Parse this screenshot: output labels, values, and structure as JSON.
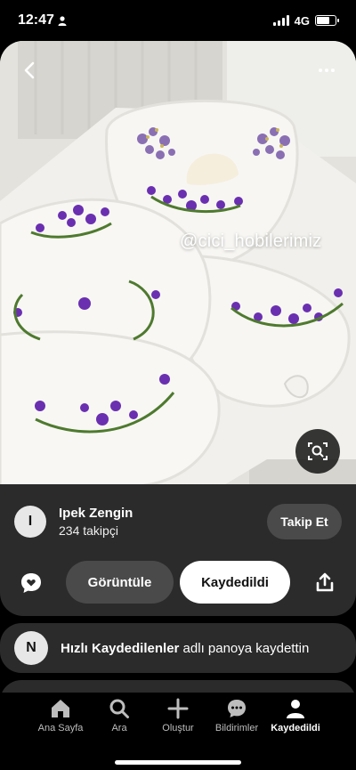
{
  "status_bar": {
    "time": "12:47",
    "network": "4G",
    "battery_level": 0.7
  },
  "pin": {
    "watermark": "@cici_hobilerimiz",
    "icons": {
      "back": "chevron-left-icon",
      "more": "more-horizontal-icon",
      "lens": "visual-search-icon"
    }
  },
  "creator": {
    "initial": "I",
    "name": "Ipek Zengin",
    "followers": "234 takipçi",
    "follow_label": "Takip Et"
  },
  "actions": {
    "view_label": "Görüntüle",
    "saved_label": "Kaydedildi",
    "icons": {
      "comment": "comment-heart-icon",
      "share": "share-icon"
    }
  },
  "board_notice": {
    "initial": "N",
    "board_name": "Hızlı Kaydedilenler",
    "suffix": "adlı panoya kaydettin"
  },
  "tab_bar": {
    "items": [
      {
        "label": "Ana Sayfa",
        "icon": "home-icon",
        "active": false
      },
      {
        "label": "Ara",
        "icon": "search-icon",
        "active": false
      },
      {
        "label": "Oluştur",
        "icon": "plus-icon",
        "active": false
      },
      {
        "label": "Bildirimler",
        "icon": "chat-bubble-icon",
        "active": false
      },
      {
        "label": "Kaydedildi",
        "icon": "profile-icon",
        "active": true
      }
    ]
  },
  "colors": {
    "background": "#000000",
    "card": "#2b2b2b",
    "pill": "#4a4a4a",
    "embroidery_purple": "#6a2fb0",
    "leaf_green": "#4e7a2e"
  }
}
